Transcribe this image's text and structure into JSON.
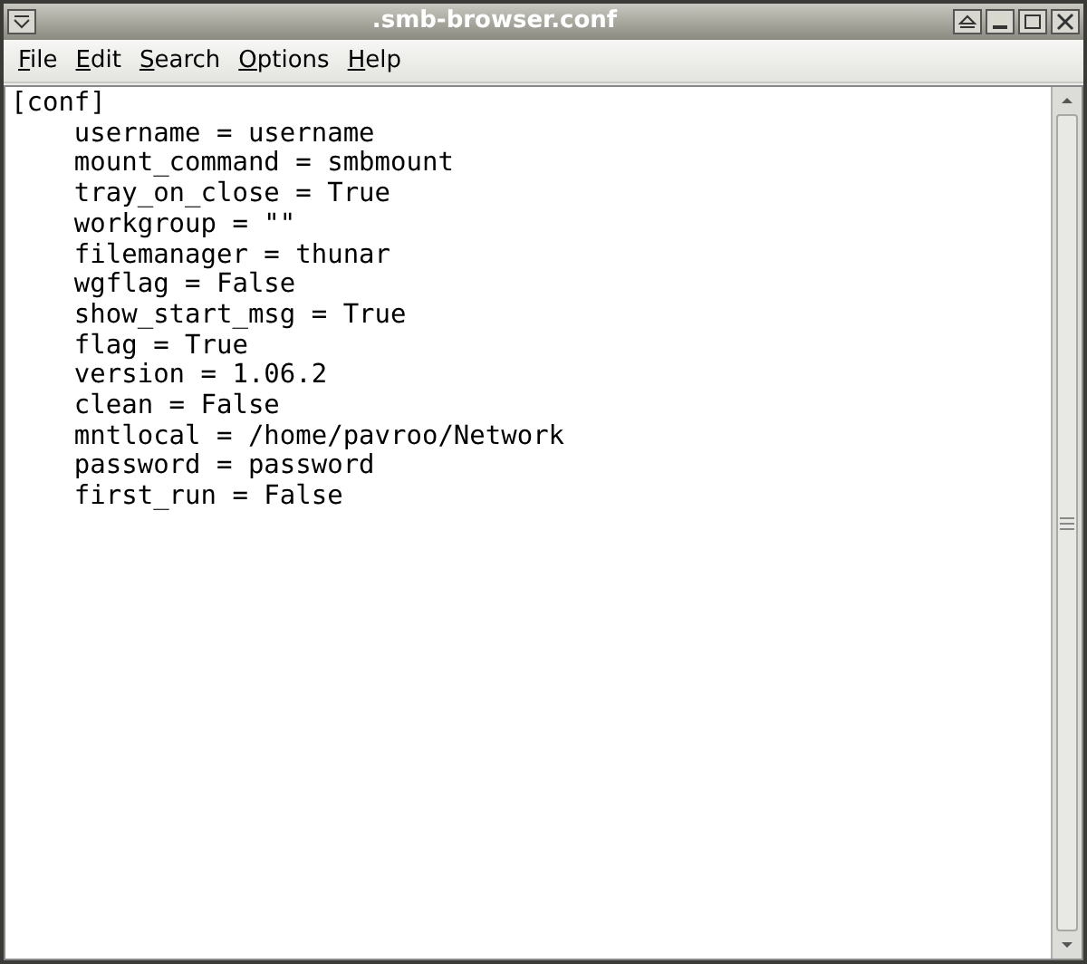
{
  "window": {
    "title": ".smb-browser.conf"
  },
  "menu": [
    "File",
    "Edit",
    "Search",
    "Options",
    "Help"
  ],
  "editor": {
    "lines": [
      "[conf]",
      "    username = username",
      "    mount_command = smbmount",
      "    tray_on_close = True",
      "    workgroup = \"\"",
      "    filemanager = thunar",
      "    wgflag = False",
      "    show_start_msg = True",
      "    flag = True",
      "    version = 1.06.2",
      "    clean = False",
      "    mntlocal = /home/pavroo/Network",
      "    password = password",
      "    first_run = False"
    ]
  }
}
